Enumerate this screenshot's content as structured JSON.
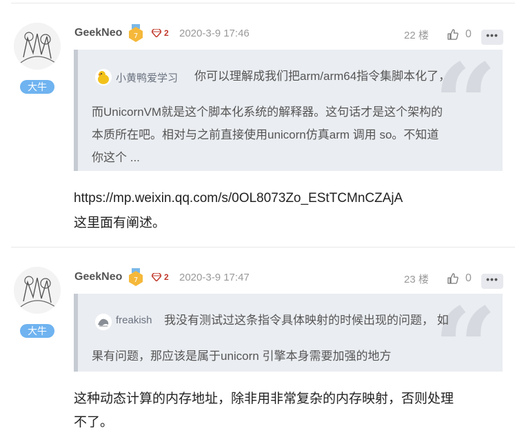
{
  "comments": [
    {
      "username": "GeekNeo",
      "rank_badge": "大牛",
      "gem_count": "2",
      "time": "2020-3-9 17:46",
      "floor": "22 楼",
      "like_count": "0",
      "more_label": "•••",
      "quote": {
        "user": "小黄鸭爱学习",
        "lines": [
          "你可以理解成我们把arm/arm64指令集脚本化了，",
          "而UnicornVM就是这个脚本化系统的解释器。这句话才是这个架构的",
          "本质所在吧。相对与之前直接使用unicorn仿真arm 调用 so。不知道",
          "你这个 ..."
        ]
      },
      "body": [
        "https://mp.weixin.qq.com/s/0OL8073Zo_EStTCMnCZAjA",
        "这里面有阐述。"
      ]
    },
    {
      "username": "GeekNeo",
      "rank_badge": "大牛",
      "gem_count": "2",
      "time": "2020-3-9 17:47",
      "floor": "23 楼",
      "like_count": "0",
      "more_label": "•••",
      "quote": {
        "user": "freakish",
        "lines": [
          "我没有测试过这条指令具体映射的时候出现的问题， 如",
          "果有问题，那应该是属于unicorn 引擎本身需要加强的地方"
        ]
      },
      "body": [
        "这种动态计算的内存地址，除非用非常复杂的内存映射，否则处理",
        "不了。"
      ]
    }
  ],
  "colors": {
    "rank_badge": "#6fb3f0",
    "level_badge": "#f5b83a",
    "gem": "#c0392b",
    "quote_bg": "#eaedf1",
    "quote_border": "#c6cbd3"
  },
  "icons": {
    "level": "level-7-badge-icon",
    "gem": "diamond-icon",
    "like": "thumbs-up-icon",
    "more": "ellipsis-icon",
    "quote": "quote-mark-icon"
  }
}
